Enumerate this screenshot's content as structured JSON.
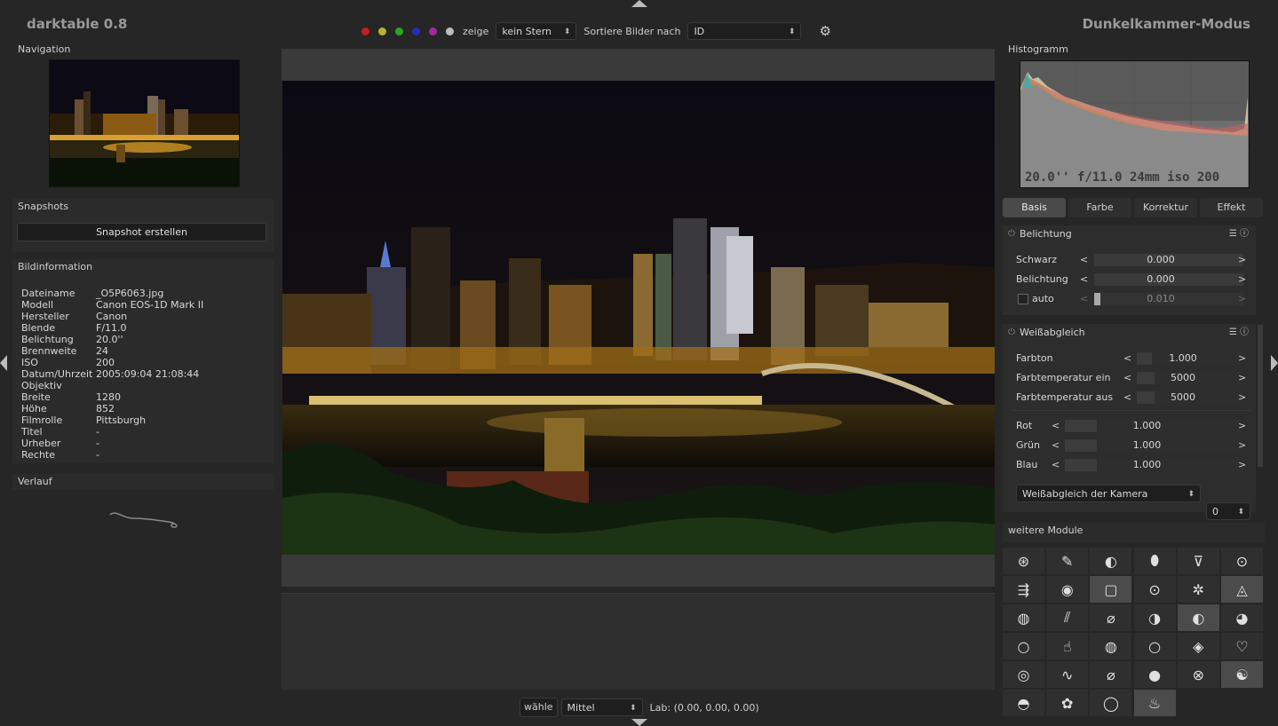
{
  "app": {
    "title": "darktable 0.8",
    "mode": "Dunkelkammer-Modus"
  },
  "topbar": {
    "color_dots": [
      "#c02020",
      "#b5b52a",
      "#2aa52a",
      "#2a2ac0",
      "#a02aa0",
      "#bdbdbd"
    ],
    "show_label": "zeige",
    "rating_value": "kein Stern",
    "sort_label": "Sortiere Bilder nach",
    "sort_value": "ID",
    "settings_icon": "gear-icon"
  },
  "left": {
    "navigation_title": "Navigation",
    "snapshots_title": "Snapshots",
    "snapshot_button": "Snapshot erstellen",
    "info_title": "Bildinformation",
    "info": [
      {
        "key": "Dateiname",
        "value": "_O5P6063.jpg"
      },
      {
        "key": "Modell",
        "value": "Canon EOS-1D Mark II"
      },
      {
        "key": "Hersteller",
        "value": "Canon"
      },
      {
        "key": "Blende",
        "value": "F/11.0"
      },
      {
        "key": "Belichtung",
        "value": "20.0''"
      },
      {
        "key": "Brennweite",
        "value": "24"
      },
      {
        "key": "ISO",
        "value": "200"
      },
      {
        "key": "Datum/Uhrzeit",
        "value": "2005:09:04 21:08:44"
      },
      {
        "key": "Objektiv",
        "value": ""
      },
      {
        "key": "Breite",
        "value": "1280"
      },
      {
        "key": "Höhe",
        "value": "852"
      },
      {
        "key": "Filmrolle",
        "value": "Pittsburgh"
      },
      {
        "key": "Titel",
        "value": "-"
      },
      {
        "key": "Urheber",
        "value": "-"
      },
      {
        "key": "Rechte",
        "value": "-"
      }
    ],
    "history_title": "Verlauf"
  },
  "bottombar": {
    "pick_label": "wähle",
    "pick_value": "Mittel",
    "lab_readout": "Lab: (0.00, 0.00, 0.00)"
  },
  "right": {
    "histogram_title": "Histogramm",
    "histogram_info": "20.0'' f/11.0 24mm iso 200",
    "tabs": [
      "Basis",
      "Farbe",
      "Korrektur",
      "Effekt"
    ],
    "exposure": {
      "title": "Belichtung",
      "black_label": "Schwarz",
      "black_value": "0.000",
      "black_level": 0.0,
      "exposure_label": "Belichtung",
      "exposure_value": "0.000",
      "exposure_level": 0.0,
      "auto_label": "auto",
      "auto_value": "0.010",
      "auto_level": 0.04
    },
    "whitebalance": {
      "title": "Weißabgleich",
      "tint_label": "Farbton",
      "tint_value": "1.000",
      "tint_level": 0.14,
      "temp_in_label": "Farbtemperatur ein",
      "temp_in_value": "5000",
      "temp_in_level": 0.17,
      "temp_out_label": "Farbtemperatur aus",
      "temp_out_value": "5000",
      "temp_out_level": 0.17,
      "red_label": "Rot",
      "red_value": "1.000",
      "red_level": 0.18,
      "green_label": "Grün",
      "green_value": "1.000",
      "green_level": 0.18,
      "blue_label": "Blau",
      "blue_value": "1.000",
      "blue_level": 0.18,
      "preset_value": "Weißabgleich der Kamera",
      "spin_value": "0"
    },
    "more_modules_title": "weitere Module",
    "module_icons": [
      "⊛",
      "✎",
      "◐",
      "⬮",
      "⊽",
      "⊙",
      "⇶",
      "◉",
      "▢",
      "⊙",
      "✲",
      "◬",
      "◍",
      "⫽",
      "⌀",
      "◑",
      "◐",
      "◕",
      "○",
      "☝",
      "◍",
      "○",
      "◈",
      "♡",
      "◎",
      "∿",
      "⌀",
      "●",
      "⊗",
      "☯",
      "◓",
      "✿",
      "◯",
      "♨"
    ],
    "module_icons_active": [
      8,
      11,
      16,
      29,
      33
    ]
  }
}
